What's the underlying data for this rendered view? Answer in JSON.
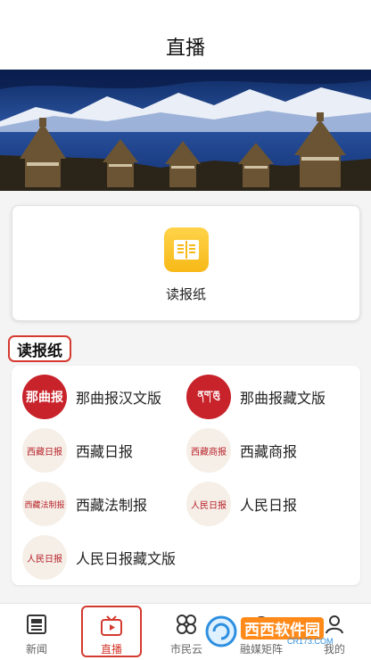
{
  "header": {
    "title": "直播"
  },
  "banner": {
    "alt_icon": "tibet-stupa-lake-photo"
  },
  "main_card": {
    "label": "读报纸",
    "icon": "newspaper-book-icon"
  },
  "section": {
    "title": "读报纸"
  },
  "papers": [
    {
      "name": "那曲报汉文版",
      "logo_text": "那曲报",
      "style": "red"
    },
    {
      "name": "那曲报藏文版",
      "logo_text": "ནག་ཆུ",
      "style": "red"
    },
    {
      "name": "西藏日报",
      "logo_text": "西藏日报",
      "style": "light"
    },
    {
      "name": "西藏商报",
      "logo_text": "西藏商报",
      "style": "light"
    },
    {
      "name": "西藏法制报",
      "logo_text": "西藏法制报",
      "style": "light"
    },
    {
      "name": "人民日报",
      "logo_text": "人民日报",
      "style": "light"
    },
    {
      "name": "人民日报藏文版",
      "logo_text": "人民日报",
      "style": "light"
    }
  ],
  "nav": [
    {
      "label": "新闻",
      "icon": "news-icon"
    },
    {
      "label": "直播",
      "icon": "tv-play-icon",
      "active": true
    },
    {
      "label": "市民云",
      "icon": "grid-apps-icon"
    },
    {
      "label": "融媒矩阵",
      "icon": "headphone-icon"
    },
    {
      "label": "我的",
      "icon": "user-icon"
    }
  ],
  "watermark": {
    "text": "西西软件园",
    "sub": "CR173.COM"
  },
  "colors": {
    "accent": "#d43a2f",
    "logo_red": "#c8222a",
    "icon_yellow": "#f7b917"
  }
}
